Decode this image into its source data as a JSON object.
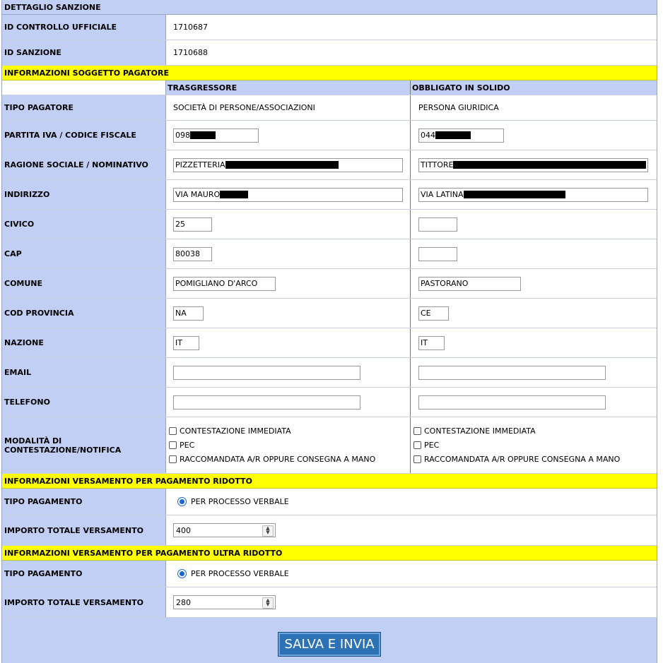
{
  "header": {
    "title": "DETTAGLIO SANZIONE"
  },
  "ids": {
    "controllo_label": "ID CONTROLLO UFFICIALE",
    "controllo_value": "1710687",
    "sanzione_label": "ID SANZIONE",
    "sanzione_value": "1710688"
  },
  "pagatore": {
    "section_title": "INFORMAZIONI SOGGETTO PAGATORE",
    "col1": "TRASGRESSORE",
    "col2": "OBBLIGATO IN SOLIDO",
    "labels": {
      "tipo": "TIPO PAGATORE",
      "piva": "PARTITA IVA / CODICE FISCALE",
      "ragione": "RAGIONE SOCIALE / NOMINATIVO",
      "indirizzo": "INDIRIZZO",
      "civico": "CIVICO",
      "cap": "CAP",
      "comune": "COMUNE",
      "provincia": "COD PROVINCIA",
      "nazione": "NAZIONE",
      "email": "EMAIL",
      "telefono": "TELEFONO",
      "modalita": "MODALITÀ DI CONTESTAZIONE/NOTIFICA"
    },
    "trasgressore": {
      "tipo": "SOCIETÀ DI PERSONE/ASSOCIAZIONI",
      "piva": "098",
      "ragione": "PIZZETTERIA",
      "indirizzo": "VIA MAURO",
      "civico": "25",
      "cap": "80038",
      "comune": "POMIGLIANO D'ARCO",
      "provincia": "NA",
      "nazione": "IT",
      "email": "",
      "telefono": ""
    },
    "obbligato": {
      "tipo": "PERSONA GIURIDICA",
      "piva": "044",
      "ragione": "TITTORE",
      "indirizzo": "VIA LATINA",
      "civico": "",
      "cap": "",
      "comune": "PASTORANO",
      "provincia": "CE",
      "nazione": "IT",
      "email": "",
      "telefono": ""
    },
    "modalita_options": [
      "CONTESTAZIONE IMMEDIATA",
      "PEC",
      "RACCOMANDATA A/R OPPURE CONSEGNA A MANO"
    ]
  },
  "ridotto": {
    "section_title": "INFORMAZIONI VERSAMENTO PER PAGAMENTO RIDOTTO",
    "tipo_label": "TIPO PAGAMENTO",
    "tipo_value": "PER PROCESSO VERBALE",
    "importo_label": "IMPORTO TOTALE VERSAMENTO",
    "importo_value": "400"
  },
  "ultra": {
    "section_title": "INFORMAZIONI VERSAMENTO PER PAGAMENTO ULTRA RIDOTTO",
    "tipo_label": "TIPO PAGAMENTO",
    "tipo_value": "PER PROCESSO VERBALE",
    "importo_label": "IMPORTO TOTALE VERSAMENTO",
    "importo_value": "280"
  },
  "footer": {
    "submit_label": "SALVA E INVIA"
  }
}
